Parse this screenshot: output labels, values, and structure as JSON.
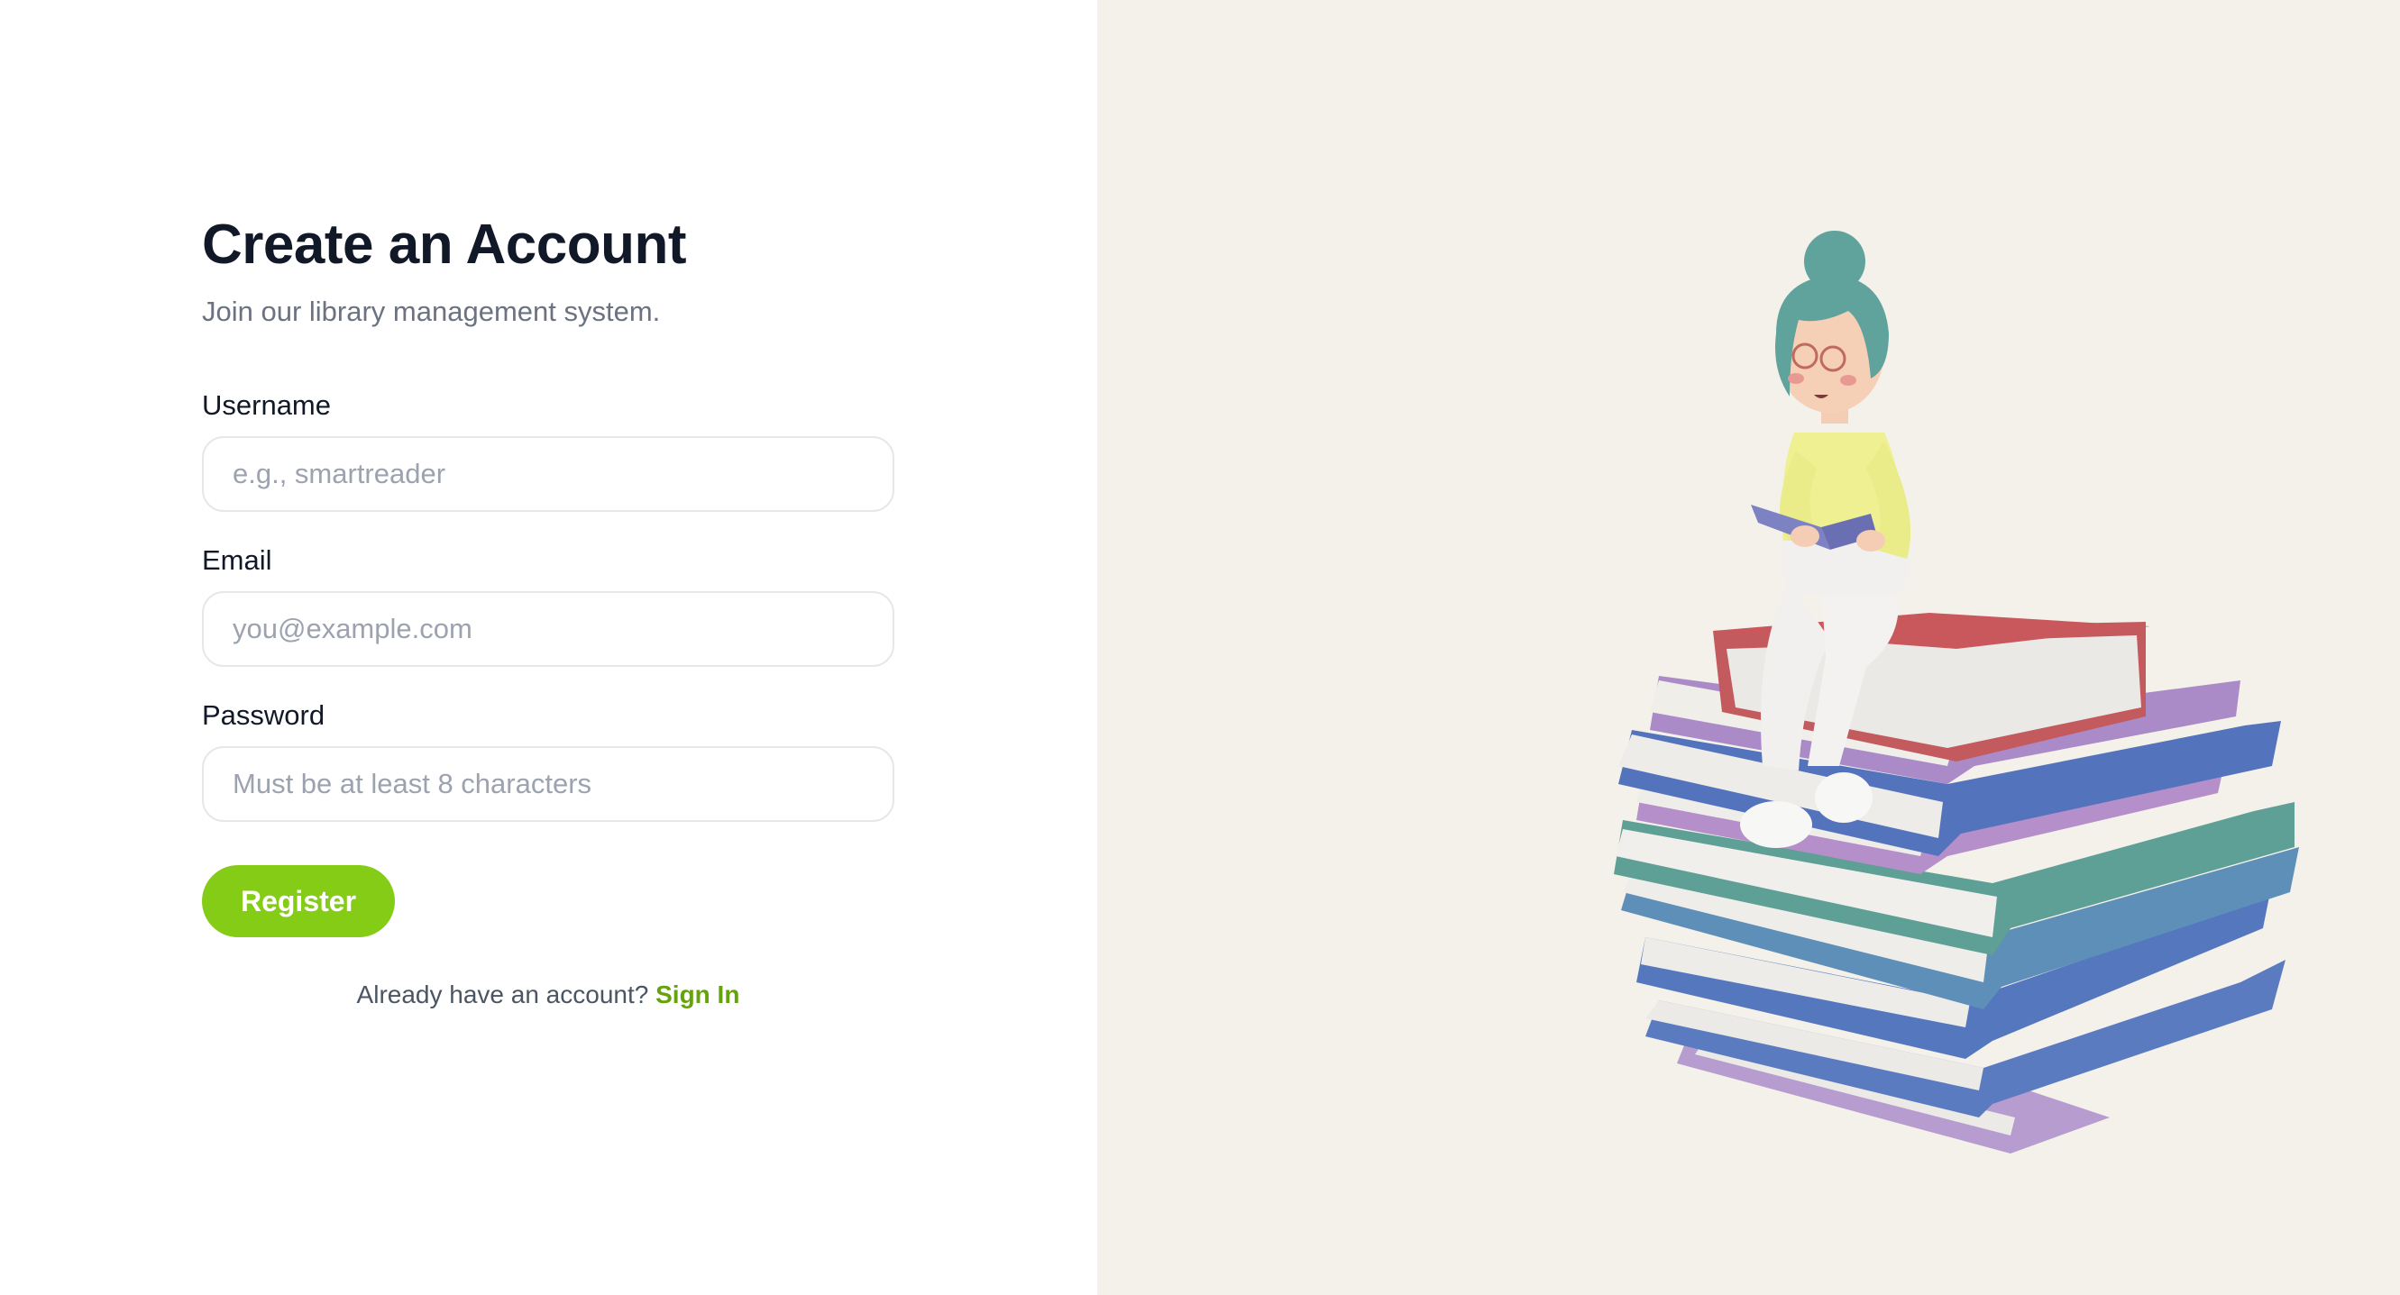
{
  "page": {
    "title": "Create an Account",
    "subtitle": "Join our library management system."
  },
  "form": {
    "username": {
      "label": "Username",
      "placeholder": "e.g., smartreader",
      "value": ""
    },
    "email": {
      "label": "Email",
      "placeholder": "you@example.com",
      "value": ""
    },
    "password": {
      "label": "Password",
      "placeholder": "Must be at least 8 characters",
      "value": ""
    },
    "submit_label": "Register"
  },
  "footer": {
    "prompt": "Already have an account?",
    "link_label": "Sign In"
  },
  "illustration": {
    "description_icon": "woman-reading-on-book-stack-illustration"
  },
  "colors": {
    "accent": "#84cc16",
    "link": "#65a30d",
    "right_panel_bg": "#f4f1ea",
    "title": "#111827",
    "muted_text": "#6b7280"
  }
}
